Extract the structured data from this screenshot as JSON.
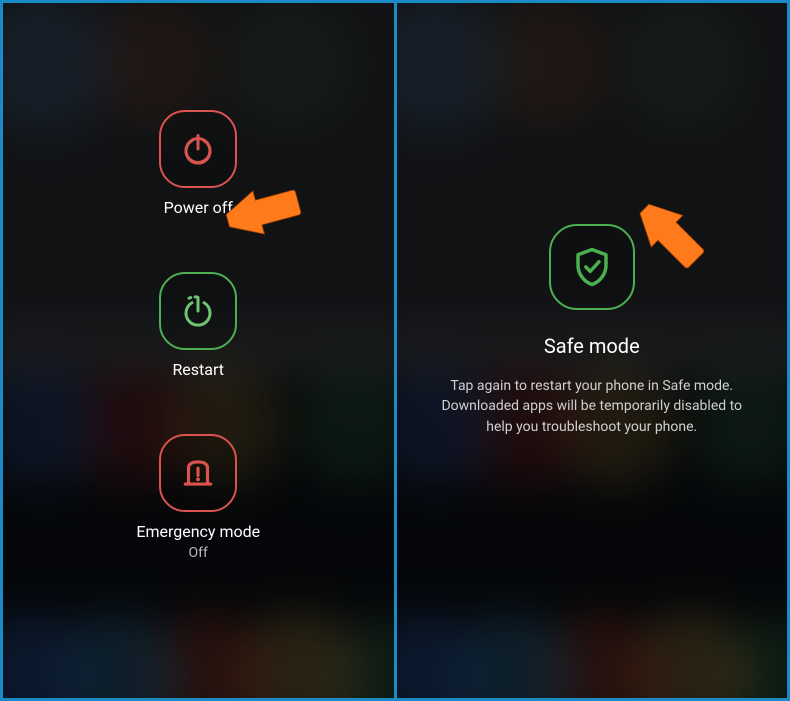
{
  "left": {
    "power_off": {
      "label": "Power off",
      "color": "#d9534f"
    },
    "restart": {
      "label": "Restart",
      "color": "#4caf50"
    },
    "emergency": {
      "label": "Emergency mode",
      "status": "Off",
      "color": "#d9534f"
    }
  },
  "right": {
    "safe_mode": {
      "title": "Safe mode",
      "description": "Tap again to restart your phone in Safe mode. Downloaded apps will be temporarily disabled to help you troubleshoot your phone.",
      "color": "#4caf50"
    }
  },
  "annotation": {
    "arrow_color": "#ff7a1a"
  }
}
